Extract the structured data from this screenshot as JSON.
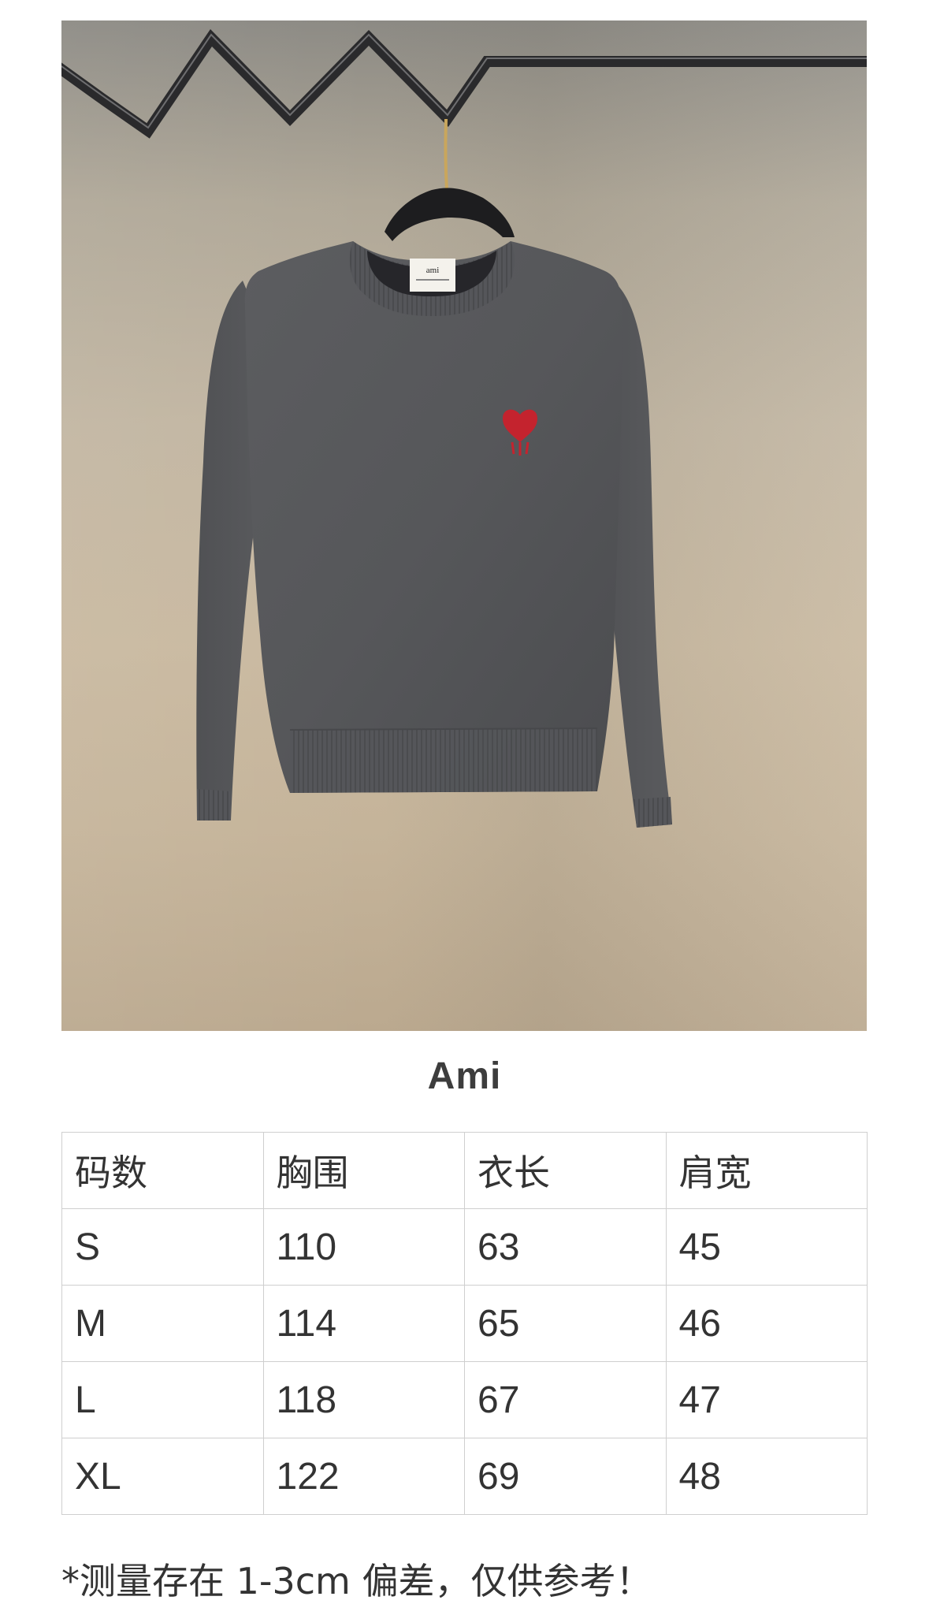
{
  "product": {
    "photo_alt": "",
    "label_text": "ami",
    "colors": {
      "sweater": "#555658",
      "logo": "#c4232e",
      "rack": "#2a2a2c",
      "background": "#c4b49c"
    }
  },
  "brand": {
    "title": "Ami"
  },
  "size_table": {
    "headers": [
      "码数",
      "胸围",
      "衣长",
      "肩宽"
    ],
    "rows": [
      [
        "S",
        "110",
        "63",
        "45"
      ],
      [
        "M",
        "114",
        "65",
        "46"
      ],
      [
        "L",
        "118",
        "67",
        "47"
      ],
      [
        "XL",
        "122",
        "69",
        "48"
      ]
    ]
  },
  "footnote": "*测量存在 1-3cm 偏差，仅供参考！"
}
